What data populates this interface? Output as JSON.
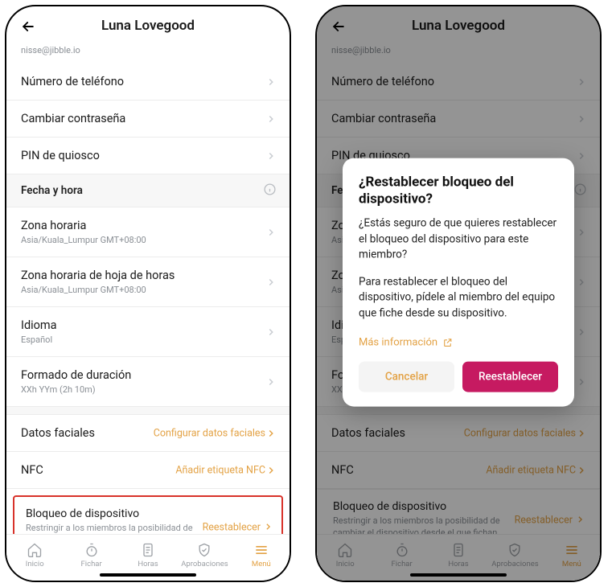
{
  "header": {
    "title": "Luna Lovegood"
  },
  "email": "nisse@jibble.io",
  "rows": {
    "phone": "Número de teléfono",
    "password": "Cambiar contraseña",
    "kiosk_pin": "PIN de quiosco"
  },
  "section_date": {
    "title": "Fecha y hora"
  },
  "tz": {
    "title": "Zona horaria",
    "sub": "Asia/Kuala_Lumpur GMT+08:00"
  },
  "ts_tz": {
    "title": "Zona horaria de hoja de horas",
    "sub": "Asia/Kuala_Lumpur GMT+08:00"
  },
  "lang": {
    "title": "Idioma",
    "sub": "Español"
  },
  "dur": {
    "title": "Formado de duración",
    "sub": "XXh YYm (2h 10m)"
  },
  "face": {
    "title": "Datos faciales",
    "action": "Configurar datos faciales"
  },
  "nfc": {
    "title": "NFC",
    "action": "Añadir etiqueta NFC"
  },
  "lock": {
    "title": "Bloqueo de dispositivo",
    "sub": "Restringir a los miembros la posibilidad de cambiar el dispositivo desde el que fichan.",
    "action": "Reestablecer"
  },
  "tabs": {
    "home": "Inicio",
    "clock": "Fichar",
    "hours": "Horas",
    "approvals": "Aprobaciones",
    "menu": "Menú"
  },
  "modal": {
    "title": "¿Restablecer bloqueo del dispositivo?",
    "p1": "¿Estás seguro de que quieres restablecer el bloqueo del dispositivo para este miembro?",
    "p2": "Para restablecer el bloqueo del dispositivo, pídele al miembro del equipo que fiche desde su dispositivo.",
    "more": "Más información",
    "cancel": "Cancelar",
    "confirm": "Reestablecer"
  }
}
